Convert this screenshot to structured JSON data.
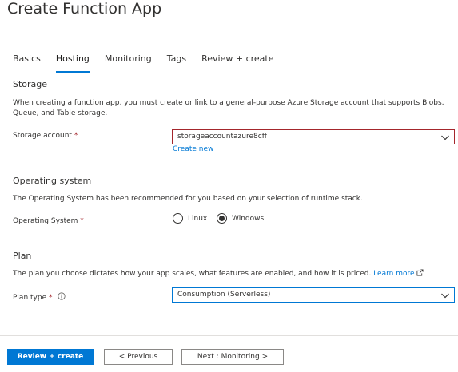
{
  "page": {
    "title": "Create Function App"
  },
  "tabs": [
    {
      "label": "Basics",
      "active": false
    },
    {
      "label": "Hosting",
      "active": true
    },
    {
      "label": "Monitoring",
      "active": false
    },
    {
      "label": "Tags",
      "active": false
    },
    {
      "label": "Review + create",
      "active": false
    }
  ],
  "storage": {
    "heading": "Storage",
    "description": "When creating a function app, you must create or link to a general-purpose Azure Storage account that supports Blobs, Queue, and Table storage.",
    "field_label": "Storage account",
    "required_mark": "*",
    "value": "storageaccountazure8cff",
    "create_new": "Create new"
  },
  "os": {
    "heading": "Operating system",
    "description": "The Operating System has been recommended for you based on your selection of runtime stack.",
    "field_label": "Operating System",
    "required_mark": "*",
    "options": [
      {
        "label": "Linux",
        "checked": false
      },
      {
        "label": "Windows",
        "checked": true
      }
    ]
  },
  "plan": {
    "heading": "Plan",
    "description": "The plan you choose dictates how your app scales, what features are enabled, and how it is priced.",
    "learn_more": "Learn more",
    "field_label": "Plan type",
    "required_mark": "*",
    "value": "Consumption (Serverless)"
  },
  "footer": {
    "review_create": "Review + create",
    "previous": "< Previous",
    "next": "Next : Monitoring >"
  },
  "colors": {
    "accent": "#0078d4",
    "error_border": "#a4262c",
    "text": "#323130"
  }
}
